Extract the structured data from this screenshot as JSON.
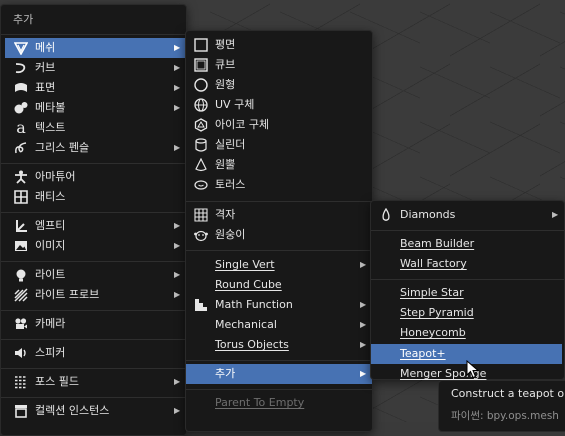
{
  "add_menu": {
    "title": "추가",
    "items": {
      "mesh": "메쉬",
      "curve": "커브",
      "surface": "표면",
      "metaball": "메타볼",
      "text": "텍스트",
      "grease_pencil": "그리스 펜슬",
      "armature": "아마튜어",
      "lattice": "래티스",
      "empty": "엠프티",
      "image": "이미지",
      "light": "라이트",
      "light_probe": "라이트 프로브",
      "camera": "카메라",
      "speaker": "스피커",
      "force_field": "포스 필드",
      "collection_instance": "컬렉션 인스턴스"
    }
  },
  "mesh_menu": {
    "items": {
      "plane": "평면",
      "cube": "큐브",
      "circle": "원형",
      "uv_sphere": "UV 구체",
      "ico_sphere": "아이코 구체",
      "cylinder": "실린더",
      "cone": "원뿔",
      "torus": "토러스",
      "grid": "격자",
      "monkey": "원숭이",
      "single_vert": "Single Vert",
      "round_cube": "Round Cube",
      "math_function": "Math Function",
      "mechanical": "Mechanical",
      "torus_objects": "Torus Objects",
      "extras": "추가",
      "parent_to_empty": "Parent To Empty"
    }
  },
  "extras_menu": {
    "items": {
      "diamonds": "Diamonds",
      "beam_builder": "Beam Builder",
      "wall_factory": "Wall Factory",
      "simple_star": "Simple Star",
      "step_pyramid": "Step Pyramid",
      "honeycomb": "Honeycomb",
      "teapot": "Teapot+",
      "menger_sponge": "Menger Sponge"
    }
  },
  "tooltip": {
    "description": "Construct a teapot or te",
    "python": "파이썬: bpy.ops.mesh"
  },
  "colors": {
    "highlight": "#4772b3",
    "menu_bg": "#181818",
    "viewport": "#3b3b3b"
  }
}
